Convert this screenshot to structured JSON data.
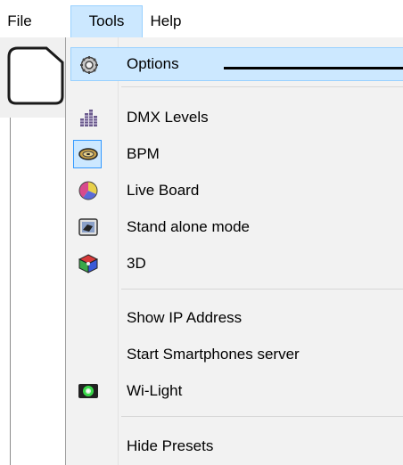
{
  "menubar": {
    "file": "File",
    "tools": "Tools",
    "help": "Help"
  },
  "menu": {
    "options": "Options",
    "dmx_levels": "DMX Levels",
    "bpm": "BPM",
    "live_board": "Live Board",
    "stand_alone": "Stand alone mode",
    "three_d": "3D",
    "show_ip": "Show IP Address",
    "start_server": "Start Smartphones server",
    "wi_light": "Wi-Light",
    "hide_presets": "Hide Presets"
  },
  "icons": {
    "options": "gear-icon",
    "dmx_levels": "bar-levels-icon",
    "bpm": "disc-icon",
    "live_board": "color-wheel-icon",
    "stand_alone": "device-icon",
    "three_d": "cube-icon",
    "wi_light": "wifi-light-icon",
    "document": "document-icon"
  },
  "colors": {
    "highlight": "#cce8ff",
    "highlight_border": "#99d1ff",
    "menu_bg": "#f2f2f2"
  }
}
